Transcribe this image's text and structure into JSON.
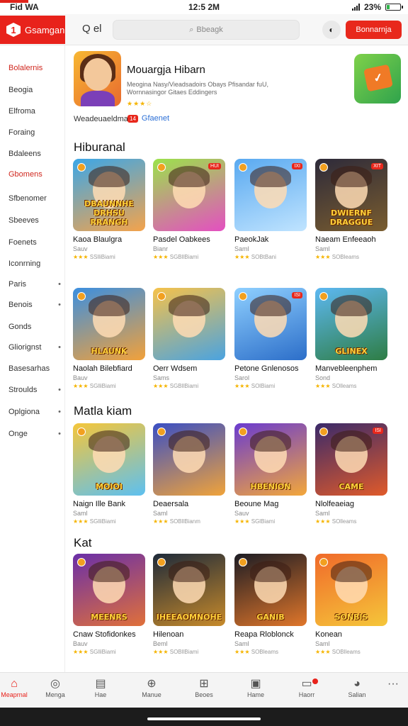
{
  "status": {
    "left": "Fid WA",
    "time": "12:5 2M",
    "battery": "23%",
    "battery_level": 0.23
  },
  "header": {
    "logo_mark": "1",
    "logo_text": "Gsamgan",
    "search_label": "Q el",
    "search_placeholder": "Bbeagk",
    "icon_button": "circle-icon",
    "cta_label": "Bonnarnja"
  },
  "sidebar": {
    "items": [
      {
        "label": "Bolalernis",
        "active": true,
        "has_dot": false
      },
      {
        "label": "Beogia",
        "active": false,
        "has_dot": false
      },
      {
        "label": "Elfroma",
        "active": false,
        "has_dot": false
      },
      {
        "label": "Foraing",
        "active": false,
        "has_dot": false
      },
      {
        "label": "Bdaleens",
        "active": false,
        "has_dot": false
      },
      {
        "label": "Gbomens",
        "active": true,
        "has_dot": false
      },
      {
        "label": "Sfbenomer",
        "active": false,
        "has_dot": false
      },
      {
        "label": "Sbeeves",
        "active": false,
        "has_dot": false
      },
      {
        "label": "Foenets",
        "active": false,
        "has_dot": false
      },
      {
        "label": "Iconrning",
        "active": false,
        "has_dot": false
      },
      {
        "label": "Paris",
        "active": false,
        "has_dot": true
      },
      {
        "label": "Benois",
        "active": false,
        "has_dot": true
      },
      {
        "label": "Gonds",
        "active": false,
        "has_dot": false
      },
      {
        "label": "Gliorignst",
        "active": false,
        "has_dot": true
      },
      {
        "label": "Basesarhas",
        "active": false,
        "has_dot": false
      },
      {
        "label": "Stroulds",
        "active": false,
        "has_dot": true
      },
      {
        "label": "Oplgiona",
        "active": false,
        "has_dot": true
      },
      {
        "label": "Onge",
        "active": false,
        "has_dot": true
      }
    ],
    "dot": "•"
  },
  "featured": {
    "title": "Mouargja Hibarn",
    "description": "Meogina Nasy/Vieadsadoirs Obays Pfisandar fuU, Wornnasingor Gitaes Eddingers",
    "stars": "★★★☆",
    "developer": "Weadeuaeldmar",
    "badge": "14",
    "badge_text": "Gfaenet"
  },
  "sections": [
    {
      "title": "Hiburanal",
      "tiles": [
        {
          "name": "Kaoa Blaulgra",
          "sub": "Sauv",
          "rating": "SSlliBiami",
          "stars": "★★★",
          "caption": "DBAUNNHE DRHSU RRANGH",
          "tag": "",
          "bg": "linear-gradient(160deg,#3ba7e8,#f4a34b)"
        },
        {
          "name": "Pasdel Oabkees",
          "sub": "Bianr",
          "rating": "SGBllBiami",
          "stars": "★★★",
          "caption": "",
          "tag": "HUI",
          "bg": "linear-gradient(160deg,#9be34a,#e44fc1)"
        },
        {
          "name": "PaeokJak",
          "sub": "Saml",
          "rating": "SOBtBani",
          "stars": "★★★",
          "caption": "",
          "tag": "IXI",
          "bg": "linear-gradient(160deg,#59a9f0,#c0e4ff)"
        },
        {
          "name": "Naeam Enfeeaoh",
          "sub": "Saml",
          "rating": "SOBleams",
          "stars": "★★★",
          "caption": "DWIERNF DRAGGUE",
          "tag": "XIT",
          "bg": "linear-gradient(160deg,#2d2a3a,#7a5d2f)"
        }
      ]
    },
    {
      "title": "",
      "tiles": [
        {
          "name": "Naolah Bilebfiard",
          "sub": "Bauv",
          "rating": "SGlliBiami",
          "stars": "★★★",
          "caption": "HLAUNK",
          "tag": "",
          "bg": "linear-gradient(160deg,#3b8fe0,#f2a13a)"
        },
        {
          "name": "Oerr Wdsem",
          "sub": "Sams",
          "rating": "SGBllBiami",
          "stars": "★★★",
          "caption": "",
          "tag": "",
          "bg": "linear-gradient(160deg,#f6c24a,#4aa3e0)"
        },
        {
          "name": "Petone Gnlenosos",
          "sub": "Sarol",
          "rating": "SOlBiami",
          "stars": "★★★",
          "caption": "",
          "tag": "ISI",
          "bg": "linear-gradient(160deg,#8fd0ff,#2c6ec9)"
        },
        {
          "name": "Manvebleenphem",
          "sub": "Sond",
          "rating": "SOlleams",
          "stars": "★★★",
          "caption": "GLINEX",
          "tag": "",
          "bg": "linear-gradient(160deg,#5db8f2,#2e7d44)"
        }
      ]
    },
    {
      "title": "Matla kiam",
      "tiles": [
        {
          "name": "Naign Ille Bank",
          "sub": "Saml",
          "rating": "SGlliBiami",
          "stars": "★★★",
          "caption": "MOIOI",
          "tag": "",
          "bg": "linear-gradient(160deg,#f5c63a,#5dc0f0)"
        },
        {
          "name": "Deaersala",
          "sub": "Saml",
          "rating": "SOBllBianm",
          "stars": "★★★",
          "caption": "",
          "tag": "",
          "bg": "linear-gradient(160deg,#3a4fc4,#f0a33a)"
        },
        {
          "name": "Beoune Mag",
          "sub": "Sauv",
          "rating": "SGlBiami",
          "stars": "★★★",
          "caption": "HBENION",
          "tag": "",
          "bg": "linear-gradient(160deg,#6a3bd0,#f3a73a)"
        },
        {
          "name": "Nlolfeaeiag",
          "sub": "Saml",
          "rating": "SOlleams",
          "stars": "★★★",
          "caption": "CAME",
          "tag": "ISI",
          "bg": "linear-gradient(160deg,#3a2a6a,#e05a2a)"
        }
      ]
    },
    {
      "title": "Kat",
      "tiles": [
        {
          "name": "Cnaw Stofidonkes",
          "sub": "Bauv",
          "rating": "SGlliBiami",
          "stars": "★★★",
          "caption": "MEENRS",
          "tag": "",
          "bg": "linear-gradient(160deg,#6a2fa8,#e0703a)"
        },
        {
          "name": "Hilenoan",
          "sub": "Beml",
          "rating": "SOBllBiami",
          "stars": "★★★",
          "caption": "IHEEAOMNOHE",
          "tag": "",
          "bg": "linear-gradient(160deg,#1e2a3a,#c78a2a)"
        },
        {
          "name": "Reapa Rloblonck",
          "sub": "Saml",
          "rating": "SOBleams",
          "stars": "★★★",
          "caption": "GANIB",
          "tag": "",
          "bg": "linear-gradient(160deg,#1c1c24,#e0762a)"
        },
        {
          "name": "Konean",
          "sub": "Saml",
          "rating": "SOBlleams",
          "stars": "★★★",
          "caption": "SONBIS",
          "tag": "",
          "bg": "linear-gradient(160deg,#f06a2a,#f5c63a)"
        }
      ]
    }
  ],
  "bottom_nav": [
    {
      "label": "Meaprnal",
      "icon": "home-icon",
      "glyph": "⌂",
      "active": true,
      "badge": false
    },
    {
      "label": "Menga",
      "icon": "globe-icon",
      "glyph": "◎",
      "active": false,
      "badge": false
    },
    {
      "label": "Hae",
      "icon": "tv-icon",
      "glyph": "▤",
      "active": false,
      "badge": false
    },
    {
      "label": "Manue",
      "icon": "compass-icon",
      "glyph": "⊕",
      "active": false,
      "badge": false
    },
    {
      "label": "Beoes",
      "icon": "gift-icon",
      "glyph": "⊞",
      "active": false,
      "badge": false
    },
    {
      "label": "Hame",
      "icon": "calendar-icon",
      "glyph": "▣",
      "active": false,
      "badge": false
    },
    {
      "label": "Haorr",
      "icon": "chat-icon",
      "glyph": "▭",
      "active": false,
      "badge": true
    },
    {
      "label": "Salian",
      "icon": "avatar-icon",
      "glyph": "◕",
      "active": false,
      "badge": false
    },
    {
      "label": "",
      "icon": "more-icon",
      "glyph": "···",
      "active": false,
      "badge": false
    }
  ],
  "colors": {
    "accent": "#e8221b",
    "link": "#2b6fd6",
    "star": "#f5b400"
  }
}
